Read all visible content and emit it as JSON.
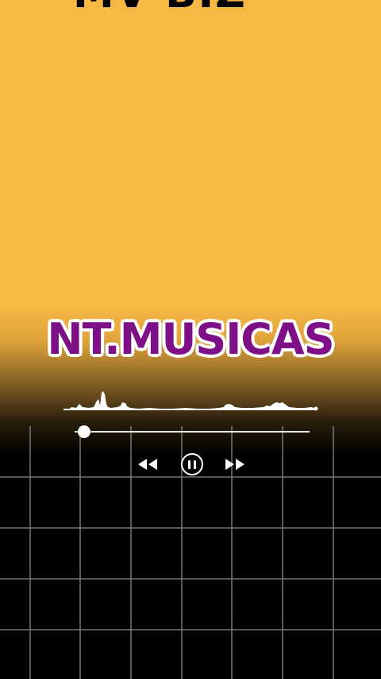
{
  "top_banner": {
    "text": "MV BIZ"
  },
  "brand": {
    "title": "NT.MUSICAS"
  },
  "player": {
    "progress_fraction": 0.04,
    "icons": {
      "rewind": "rewind-icon",
      "pause": "pause-icon",
      "forward": "fast-forward-icon"
    }
  },
  "colors": {
    "background_top": "#f7b944",
    "background_bottom": "#000000",
    "brand_fill": "#7d0f87",
    "brand_outline": "#ffffff",
    "controls": "#ffffff",
    "grid_lines": "#8a8a8a"
  }
}
